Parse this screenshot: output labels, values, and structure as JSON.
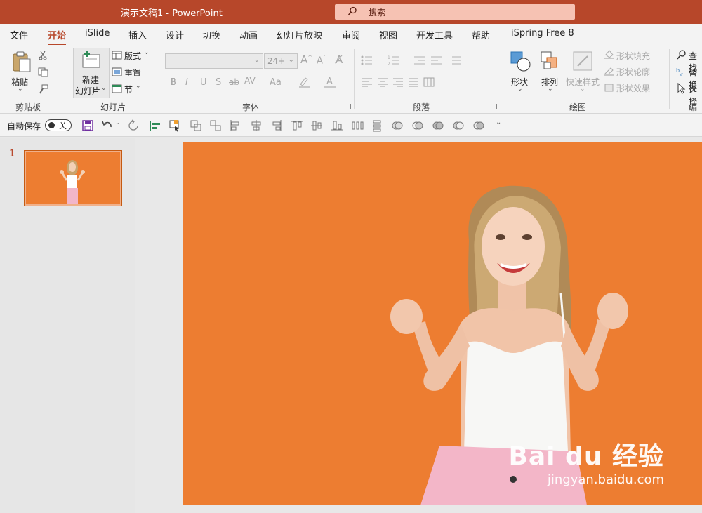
{
  "window": {
    "title": "演示文稿1  -  PowerPoint"
  },
  "search": {
    "label": "搜索"
  },
  "tabs": [
    {
      "label": "文件"
    },
    {
      "label": "开始"
    },
    {
      "label": "iSlide"
    },
    {
      "label": "插入"
    },
    {
      "label": "设计"
    },
    {
      "label": "切换"
    },
    {
      "label": "动画"
    },
    {
      "label": "幻灯片放映"
    },
    {
      "label": "审阅"
    },
    {
      "label": "视图"
    },
    {
      "label": "开发工具"
    },
    {
      "label": "帮助"
    },
    {
      "label": "iSpring Free 8"
    }
  ],
  "ribbon": {
    "clipboard": {
      "paste": "粘贴",
      "group": "剪贴板"
    },
    "slides": {
      "new_slide_1": "新建",
      "new_slide_2": "幻灯片",
      "layout": "版式",
      "reset": "重置",
      "section": "节",
      "group": "幻灯片"
    },
    "font": {
      "font_size": "24+",
      "group": "字体"
    },
    "paragraph": {
      "group": "段落"
    },
    "drawing": {
      "shapes": "形状",
      "arrange": "排列",
      "quick_styles": "快速样式",
      "shape_fill": "形状填充",
      "shape_outline": "形状轮廓",
      "shape_effects": "形状效果",
      "group": "绘图"
    },
    "editing": {
      "find": "查找",
      "replace": "替换",
      "select": "选择",
      "group": "编辑"
    }
  },
  "qat": {
    "autosave": "自动保存",
    "toggle": "关"
  },
  "thumbnails": [
    {
      "number": "1"
    }
  ],
  "watermark": {
    "brand": "Bai du 经验",
    "url": "jingyan.baidu.com"
  },
  "colors": {
    "accent": "#b7472a",
    "slide_bg": "#ed7d31",
    "search_bg": "#f6c2b3"
  }
}
